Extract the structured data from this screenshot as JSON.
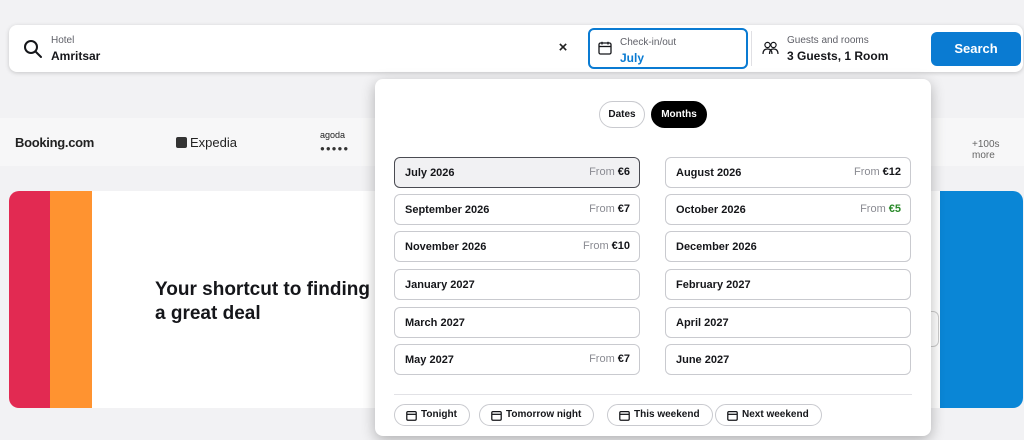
{
  "search": {
    "hotel_label": "Hotel",
    "hotel_value": "Amritsar",
    "clear_symbol": "×",
    "checkin_label": "Check-in/out",
    "checkin_value": "July",
    "guests_label": "Guests and rooms",
    "guests_value": "3 Guests, 1 Room",
    "search_button": "Search"
  },
  "partners": {
    "booking": "Booking.com",
    "expedia": "Expedia",
    "agoda": "agoda",
    "more": "+100s more"
  },
  "banner": {
    "headline": "Your shortcut to finding a great deal",
    "colors": {
      "red": "#e22a52",
      "orange": "#ff9330",
      "blue": "#0a86d6"
    }
  },
  "picker": {
    "tab_dates": "Dates",
    "tab_months": "Months",
    "active_tab": "Months",
    "from_label": "From",
    "months_left": [
      {
        "name": "July 2026",
        "price": "€6",
        "selected": true
      },
      {
        "name": "September 2026",
        "price": "€7"
      },
      {
        "name": "November 2026",
        "price": "€10"
      },
      {
        "name": "January 2027",
        "price": ""
      },
      {
        "name": "March 2027",
        "price": ""
      },
      {
        "name": "May 2027",
        "price": "€7"
      }
    ],
    "months_right": [
      {
        "name": "August 2026",
        "price": "€12"
      },
      {
        "name": "October 2026",
        "price": "€5",
        "cheapest": true
      },
      {
        "name": "December 2026",
        "price": ""
      },
      {
        "name": "February 2027",
        "price": ""
      },
      {
        "name": "April 2027",
        "price": ""
      },
      {
        "name": "June 2027",
        "price": ""
      }
    ],
    "quick_chips": [
      "Tonight",
      "Tomorrow night",
      "This weekend",
      "Next weekend"
    ]
  },
  "colors": {
    "accent": "#0a7bd2",
    "deal_green": "#2a8a2a"
  }
}
